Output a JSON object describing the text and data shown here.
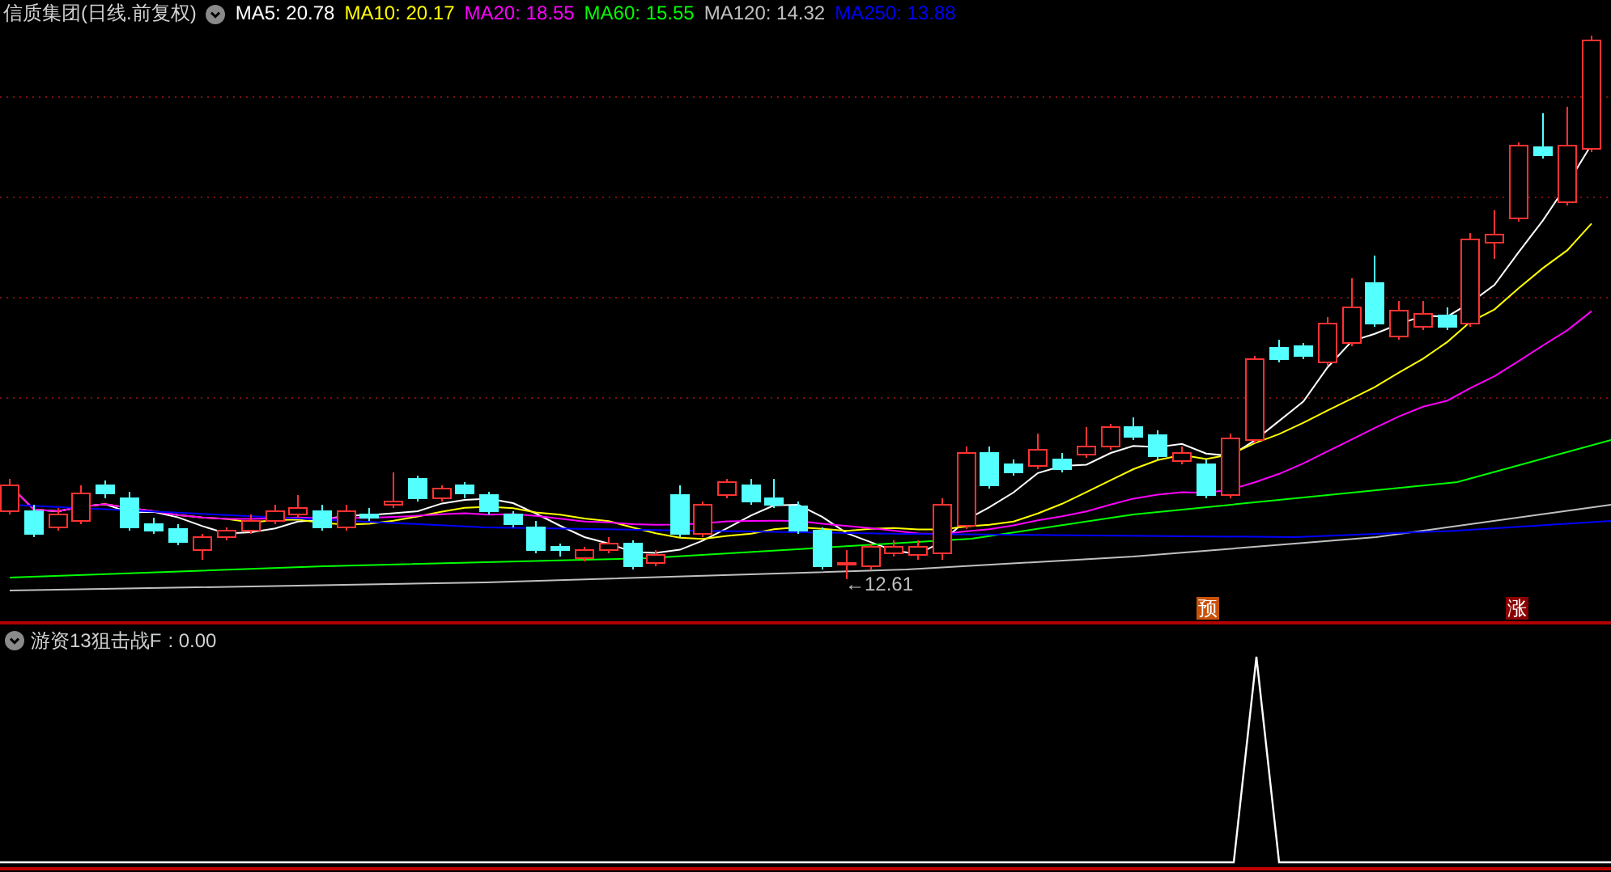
{
  "main_chart": {
    "title": "信质集团(日线.前复权)",
    "moving_averages": [
      {
        "label": "MA5: 20.78",
        "color": "#ffffff"
      },
      {
        "label": "MA10: 20.17",
        "color": "#ffff00"
      },
      {
        "label": "MA20: 18.55",
        "color": "#ff00ff"
      },
      {
        "label": "MA60: 15.55",
        "color": "#00ff00"
      },
      {
        "label": "MA120: 14.32",
        "color": "#c0c0c0"
      },
      {
        "label": "MA250: 13.88",
        "color": "#0000ff"
      }
    ],
    "low_label": "←12.61",
    "signals": [
      {
        "label": "预",
        "color": "#c8520a"
      },
      {
        "label": "涨",
        "color": "#8b0000"
      }
    ]
  },
  "indicator_panel": {
    "name": "游资13狙击战F",
    "value": ": 0.00"
  }
}
